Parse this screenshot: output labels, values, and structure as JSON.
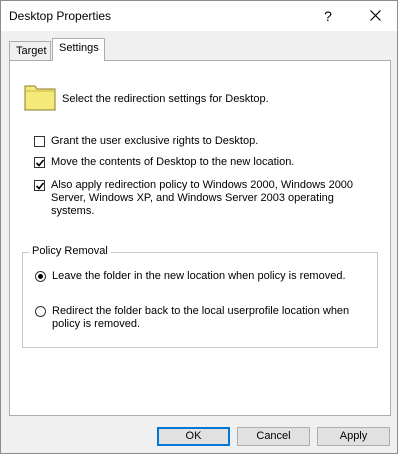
{
  "window": {
    "title": "Desktop Properties",
    "help_glyph": "?"
  },
  "tabs": [
    {
      "label": "Target",
      "active": false
    },
    {
      "label": "Settings",
      "active": true
    }
  ],
  "settings": {
    "intro": "Select the redirection settings for Desktop.",
    "options": [
      {
        "label": "Grant the user exclusive rights to Desktop.",
        "checked": false
      },
      {
        "label": "Move the contents of Desktop to the new location.",
        "checked": true
      },
      {
        "label": "Also apply redirection policy to Windows 2000, Windows 2000 Server, Windows XP, and Windows Server 2003 operating systems.",
        "checked": true
      }
    ]
  },
  "policy_removal": {
    "title": "Policy Removal",
    "options": [
      {
        "label": "Leave the folder in the new location when policy is removed.",
        "selected": true
      },
      {
        "label": "Redirect the folder back to the local userprofile location when policy is removed.",
        "selected": false
      }
    ]
  },
  "buttons": {
    "ok": "OK",
    "cancel": "Cancel",
    "apply": "Apply"
  },
  "colors": {
    "folder": "#f5e97a",
    "accent": "#0078d7"
  }
}
